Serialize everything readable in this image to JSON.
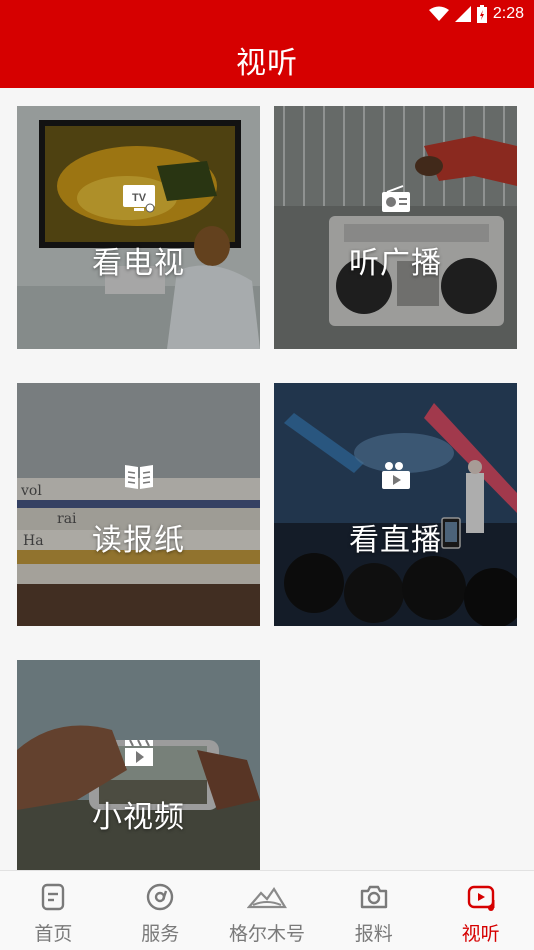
{
  "status_bar": {
    "time": "2:28",
    "icons": [
      "wifi-icon",
      "cellular-signal-icon",
      "battery-charging-icon"
    ]
  },
  "header": {
    "title": "视听",
    "background": "#d60000"
  },
  "tiles": [
    {
      "label": "看电视",
      "icon": "tv-icon"
    },
    {
      "label": "听广播",
      "icon": "radio-icon"
    },
    {
      "label": "读报纸",
      "icon": "newspaper-icon"
    },
    {
      "label": "看直播",
      "icon": "live-camera-icon"
    },
    {
      "label": "小视频",
      "icon": "video-clapper-icon"
    }
  ],
  "tabbar": {
    "items": [
      {
        "label": "首页",
        "icon": "home-doc-icon",
        "active": false
      },
      {
        "label": "服务",
        "icon": "compass-icon",
        "active": false
      },
      {
        "label": "格尔木号",
        "icon": "mountain-icon",
        "active": false
      },
      {
        "label": "报料",
        "icon": "camera-icon",
        "active": false
      },
      {
        "label": "视听",
        "icon": "video-music-icon",
        "active": true
      }
    ],
    "active_color": "#d60000",
    "inactive_color": "#7a7a7a"
  }
}
